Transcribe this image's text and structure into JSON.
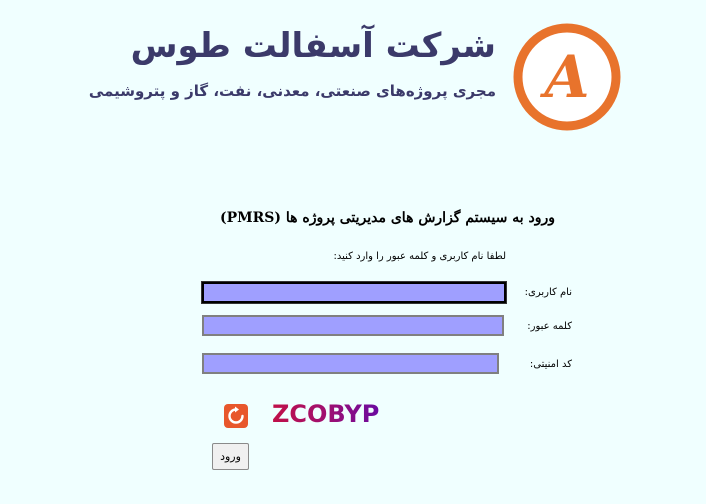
{
  "header": {
    "company_name": "شرکت آسفالت طوس",
    "tagline": "مجری پروژه‌های صنعتی، معدنی، نفت، گاز و پتروشیمی",
    "logo_letter": "A",
    "logo_color": "#e8732c",
    "text_color": "#3b3a6a"
  },
  "login": {
    "heading": "ورود به سیستم گزارش های مدیریتی پروژه ها (PMRS)",
    "instruction": "لطفا نام کاربری و کلمه عبور را وارد کنید:",
    "fields": {
      "username": {
        "label": "نام کاربری:",
        "value": ""
      },
      "password": {
        "label": "کلمه عبور:",
        "value": ""
      },
      "security": {
        "label": "کد امنیتی:",
        "value": ""
      }
    },
    "input_fill_color": "#9f9fff",
    "captcha_text": "ZCOBYP",
    "refresh_icon": "refresh-icon",
    "submit_label": "ورود"
  }
}
